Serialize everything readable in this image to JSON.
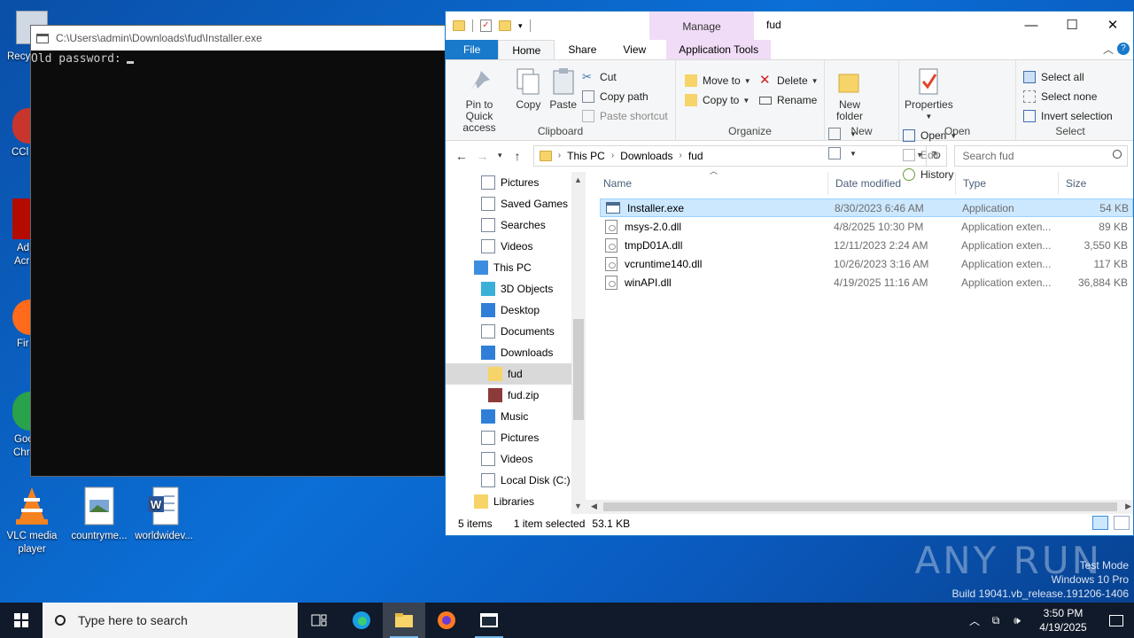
{
  "desktop": {
    "icons": [
      {
        "label": "VLC media player"
      },
      {
        "label": "countryme..."
      },
      {
        "label": "worldwidev..."
      }
    ],
    "partial_labels": [
      "Recy",
      "CCl",
      "Ad",
      "Acr",
      "Fir",
      "Goo",
      "Chr"
    ],
    "watermark": {
      "logo": "ANY RUN",
      "line1": "Test Mode",
      "line2": "Windows 10 Pro",
      "line3": "Build 19041.vb_release.191206-1406"
    }
  },
  "console": {
    "title": "C:\\Users\\admin\\Downloads\\fud\\Installer.exe",
    "prompt": "Old password:"
  },
  "explorer": {
    "window_title": "fud",
    "contextual_tab": "Manage",
    "tabs": {
      "file": "File",
      "home": "Home",
      "share": "Share",
      "view": "View",
      "app_tools": "Application Tools"
    },
    "ribbon": {
      "clipboard": {
        "pin": "Pin to Quick access",
        "copy": "Copy",
        "paste": "Paste",
        "cut": "Cut",
        "copy_path": "Copy path",
        "paste_shortcut": "Paste shortcut",
        "group": "Clipboard"
      },
      "organize": {
        "move_to": "Move to",
        "copy_to": "Copy to",
        "delete": "Delete",
        "rename": "Rename",
        "group": "Organize"
      },
      "new": {
        "new_folder": "New folder",
        "group": "New"
      },
      "open": {
        "properties": "Properties",
        "open": "Open",
        "edit": "Edit",
        "history": "History",
        "group": "Open"
      },
      "select": {
        "select_all": "Select all",
        "select_none": "Select none",
        "invert": "Invert selection",
        "group": "Select"
      }
    },
    "address": {
      "crumbs": [
        "This PC",
        "Downloads",
        "fud"
      ],
      "search_placeholder": "Search fud"
    },
    "nav": [
      {
        "label": "Pictures",
        "indent": 1
      },
      {
        "label": "Saved Games",
        "indent": 1
      },
      {
        "label": "Searches",
        "indent": 1
      },
      {
        "label": "Videos",
        "indent": 1
      },
      {
        "label": "This PC",
        "indent": 0
      },
      {
        "label": "3D Objects",
        "indent": 1
      },
      {
        "label": "Desktop",
        "indent": 1
      },
      {
        "label": "Documents",
        "indent": 1
      },
      {
        "label": "Downloads",
        "indent": 1
      },
      {
        "label": "fud",
        "indent": 2
      },
      {
        "label": "fud.zip",
        "indent": 2
      },
      {
        "label": "Music",
        "indent": 1
      },
      {
        "label": "Pictures",
        "indent": 1
      },
      {
        "label": "Videos",
        "indent": 1
      },
      {
        "label": "Local Disk (C:)",
        "indent": 1
      },
      {
        "label": "Libraries",
        "indent": 0
      }
    ],
    "columns": {
      "name": "Name",
      "date": "Date modified",
      "type": "Type",
      "size": "Size"
    },
    "files": [
      {
        "name": "Installer.exe",
        "date": "8/30/2023 6:46 AM",
        "type": "Application",
        "size": "54 KB"
      },
      {
        "name": "msys-2.0.dll",
        "date": "4/8/2025 10:30 PM",
        "type": "Application exten...",
        "size": "89 KB"
      },
      {
        "name": "tmpD01A.dll",
        "date": "12/11/2023 2:24 AM",
        "type": "Application exten...",
        "size": "3,550 KB"
      },
      {
        "name": "vcruntime140.dll",
        "date": "10/26/2023 3:16 AM",
        "type": "Application exten...",
        "size": "117 KB"
      },
      {
        "name": "winAPI.dll",
        "date": "4/19/2025 11:16 AM",
        "type": "Application exten...",
        "size": "36,884 KB"
      }
    ],
    "status": {
      "count": "5 items",
      "selected": "1 item selected",
      "size": "53.1 KB"
    }
  },
  "taskbar": {
    "search_placeholder": "Type here to search",
    "time": "3:50 PM",
    "date": "4/19/2025"
  }
}
